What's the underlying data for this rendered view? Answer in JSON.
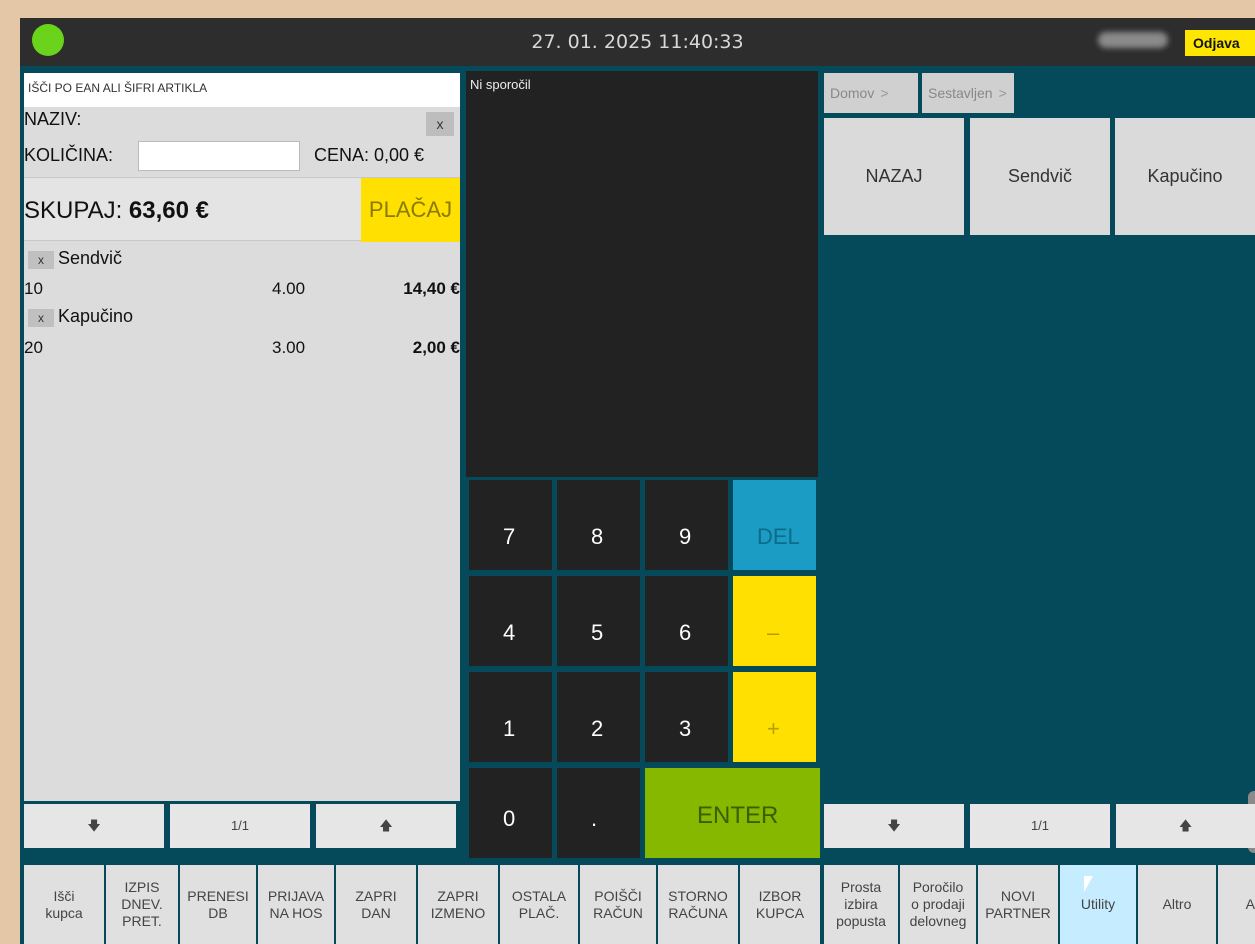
{
  "topbar": {
    "datetime": "27. 01. 2025 11:40:33",
    "logout_label": "Odjava"
  },
  "left_panel": {
    "search_placeholder": "IŠČI PO EAN ALI ŠIFRI ARTIKLA",
    "naziv_label": "NAZIV:",
    "clear_label": "x",
    "kolicina_label": "KOLIČINA:",
    "cena_label": "CENA: 0,00 €",
    "total_label": "SKUPAJ: ",
    "total_value": "63,60 €",
    "pay_label": "PLAČAJ",
    "items": [
      {
        "remove": "x",
        "name": "Sendvič",
        "code": "10",
        "qty": "4.00",
        "total": "14,40 €"
      },
      {
        "remove": "x",
        "name": "Kapučino",
        "code": "20",
        "qty": "3.00",
        "total": "2,00 €"
      }
    ],
    "pager": {
      "down": "🡇",
      "page": "1/1",
      "up": "🡅"
    }
  },
  "messages": {
    "text": "Ni sporočil"
  },
  "keypad": {
    "k7": "7",
    "k8": "8",
    "k9": "9",
    "del": "DEL",
    "k4": "4",
    "k5": "5",
    "k6": "6",
    "minus": "–",
    "k1": "1",
    "k2": "2",
    "k3": "3",
    "plus": "+",
    "k0": "0",
    "dot": ".",
    "enter": "ENTER"
  },
  "right_panel": {
    "breadcrumb": [
      "Domov",
      "Sestavljen"
    ],
    "breadcrumb_sep": ">",
    "categories": [
      "NAZAJ",
      "Sendvič",
      "Kapučino"
    ],
    "pager": {
      "down": "🡇",
      "page": "1/1",
      "up": "🡅"
    }
  },
  "functions": [
    "Išči\nkupca",
    "IZPIS\nDNEV.\nPRET.",
    "PRENESI\nDB",
    "PRIJAVA\nNA HOS",
    "ZAPRI\nDAN",
    "ZAPRI\nIZMENO",
    "OSTALA\nPLAČ.",
    "POIŠČI\nRAČUN",
    "STORNO\nRAČUNA",
    "IZBOR\nKUPCA",
    "Prosta\nizbira\npopusta",
    "Poročilo\no prodaji\ndelovneg",
    "NOVI\nPARTNER",
    "Utility",
    "Altro",
    "A"
  ],
  "colors": {
    "background": "#044a5a",
    "accent_yellow": "#ffe000",
    "enter_green": "#86b800",
    "del_blue": "#1a9cc4",
    "status_green": "#6ad41c"
  }
}
